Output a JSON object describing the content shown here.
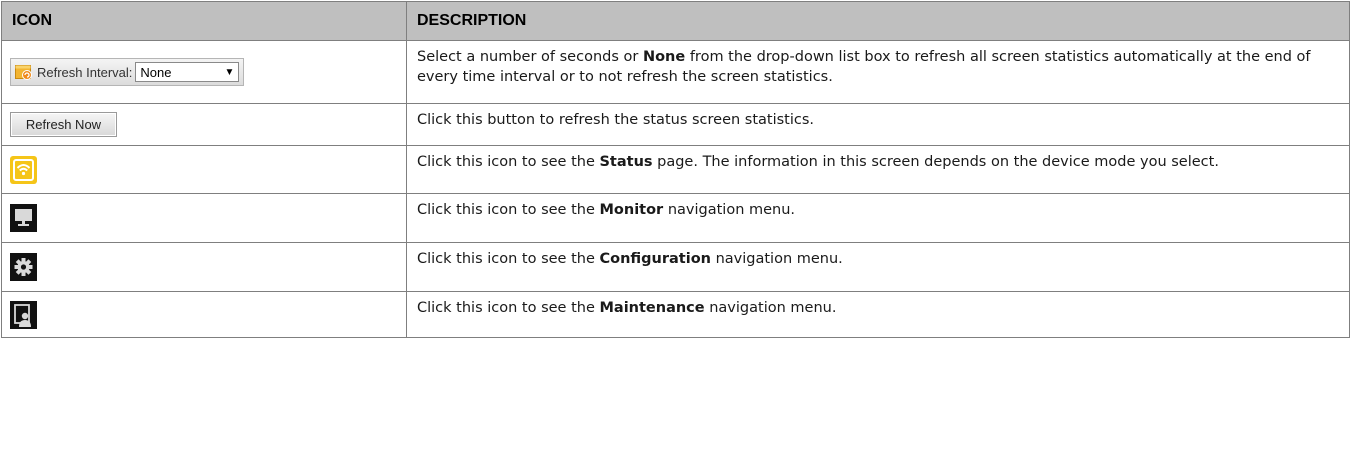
{
  "table": {
    "headers": [
      "ICON",
      "DESCRIPTION"
    ],
    "rows": [
      {
        "icon": "refresh-interval-dropdown",
        "widget": {
          "label": "Refresh Interval:",
          "selected": "None"
        },
        "desc": [
          {
            "t": "Select a number of seconds or "
          },
          {
            "t": "None",
            "b": true
          },
          {
            "t": " from the drop-down list box to refresh all screen statistics automatically at the end of every time interval or to not refresh the screen statistics."
          }
        ]
      },
      {
        "icon": "refresh-now-button",
        "button_label": "Refresh Now",
        "desc": [
          {
            "t": "Click this button to refresh the status screen statistics."
          }
        ]
      },
      {
        "icon": "status-icon",
        "desc": [
          {
            "t": "Click this icon to see the "
          },
          {
            "t": "Status",
            "b": true
          },
          {
            "t": " page. The information in this screen depends on the device mode you select."
          }
        ]
      },
      {
        "icon": "monitor-icon",
        "desc": [
          {
            "t": "Click this icon to see the "
          },
          {
            "t": "Monitor",
            "b": true
          },
          {
            "t": " navigation menu."
          }
        ]
      },
      {
        "icon": "gear-icon",
        "desc": [
          {
            "t": "Click this icon to see the "
          },
          {
            "t": "Configuration",
            "b": true
          },
          {
            "t": " navigation menu."
          }
        ]
      },
      {
        "icon": "maintenance-icon",
        "desc": [
          {
            "t": "Click this icon to see the "
          },
          {
            "t": "Maintenance",
            "b": true
          },
          {
            "t": " navigation menu."
          }
        ]
      }
    ]
  },
  "colors": {
    "header_bg": "#bfbfbf",
    "border": "#7f7f7f",
    "status_icon_bg": "#f5c518",
    "dark_icon_bg": "#111111"
  }
}
